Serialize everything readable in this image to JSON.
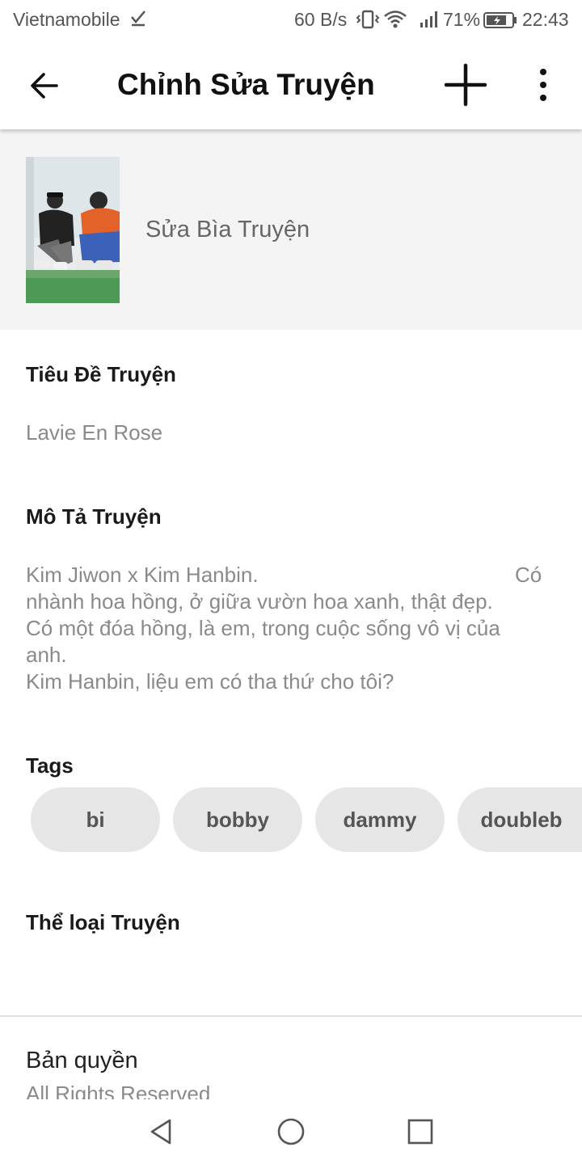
{
  "status_bar": {
    "carrier": "Vietnamobile",
    "net_speed": "60 B/s",
    "battery": "71%",
    "time": "22:43"
  },
  "app_bar": {
    "title": "Chỉnh Sửa Truyện",
    "icons": [
      "arrow-back-icon",
      "plus-icon",
      "more-vertical-icon"
    ]
  },
  "cover": {
    "label": "Sửa Bìa Truyện"
  },
  "title_field": {
    "label": "Tiêu Đề Truyện",
    "value": "Lavie En Rose"
  },
  "description_field": {
    "label": "Mô Tả Truyện",
    "lines": [
      "Kim Jiwon x Kim Hanbin.",
      "Có",
      "nhành hoa hồng, ở giữa vườn hoa xanh, thật đẹp.",
      "Có một đóa hồng, là em, trong cuộc sống vô vị của",
      "anh.",
      "Kim Hanbin, liệu em có tha thứ cho tôi?"
    ]
  },
  "tags": {
    "label": "Tags",
    "items": [
      "bi",
      "bobby",
      "dammy",
      "doubleb"
    ]
  },
  "genre": {
    "label": "Thể loại Truyện"
  },
  "copyright": {
    "label": "Bản quyền",
    "value": "All Rights Reserved"
  },
  "colors": {
    "cover_background": "#f4f4f4",
    "tag_background": "#e6e6e6"
  }
}
